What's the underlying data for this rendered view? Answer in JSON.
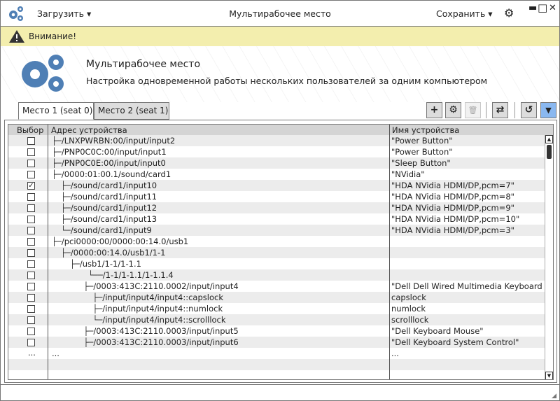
{
  "window": {
    "title": "Мультирабочее место",
    "load_menu": "Загрузить",
    "save_menu": "Сохранить",
    "minimize": "▬",
    "maximize": "□",
    "close": "✕"
  },
  "warning": {
    "text": "Внимание!"
  },
  "header": {
    "title": "Мультирабочее место",
    "subtitle": "Настройка одновременной работы нескольких пользователей за одним компьютером"
  },
  "tabs": [
    {
      "label": "Место 1 (seat 0)",
      "active": true
    },
    {
      "label": "Место 2 (seat 1)",
      "active": false
    }
  ],
  "toolbar": {
    "add": "+",
    "settings": "⚙",
    "delete": "🗑",
    "swap": "⇄",
    "refresh": "↺",
    "filter": "▼",
    "accent": "#8ab8f0"
  },
  "table": {
    "columns": [
      "Выбор",
      "Адрес устройства",
      "Имя устройства"
    ],
    "rows": [
      {
        "checked": false,
        "level": 0,
        "conn": "├─",
        "addr": "/LNXPWRBN:00/input/input2",
        "name": "\"Power Button\""
      },
      {
        "checked": false,
        "level": 0,
        "conn": "├─",
        "addr": "/PNP0C0C:00/input/input1",
        "name": "\"Power Button\""
      },
      {
        "checked": false,
        "level": 0,
        "conn": "├─",
        "addr": "/PNP0C0E:00/input/input0",
        "name": "\"Sleep Button\""
      },
      {
        "checked": false,
        "level": 0,
        "conn": "├─",
        "addr": "/0000:01:00.1/sound/card1",
        "name": "\"NVidia\""
      },
      {
        "checked": true,
        "level": 1,
        "conn": "├─",
        "addr": "/sound/card1/input10",
        "name": "\"HDA NVidia HDMI/DP,pcm=7\""
      },
      {
        "checked": false,
        "level": 1,
        "conn": "├─",
        "addr": "/sound/card1/input11",
        "name": "\"HDA NVidia HDMI/DP,pcm=8\""
      },
      {
        "checked": false,
        "level": 1,
        "conn": "├─",
        "addr": "/sound/card1/input12",
        "name": "\"HDA NVidia HDMI/DP,pcm=9\""
      },
      {
        "checked": false,
        "level": 1,
        "conn": "├─",
        "addr": "/sound/card1/input13",
        "name": "\"HDA NVidia HDMI/DP,pcm=10\""
      },
      {
        "checked": false,
        "level": 1,
        "conn": "└─",
        "addr": "/sound/card1/input9",
        "name": "\"HDA NVidia HDMI/DP,pcm=3\""
      },
      {
        "checked": false,
        "level": 0,
        "conn": "├─",
        "addr": "/pci0000:00/0000:00:14.0/usb1",
        "name": ""
      },
      {
        "checked": false,
        "level": 1,
        "conn": "├─",
        "addr": "/0000:00:14.0/usb1/1-1",
        "name": ""
      },
      {
        "checked": false,
        "level": 2,
        "conn": "├─",
        "addr": "/usb1/1-1/1-1.1",
        "name": ""
      },
      {
        "checked": false,
        "level": 4,
        "conn": "└──",
        "addr": "/1-1/1-1.1/1-1.1.4",
        "name": ""
      },
      {
        "checked": false,
        "level": 3.5,
        "conn": "├─",
        "addr": "/0003:413C:2110.0002/input/input4",
        "name": "\"Dell Dell Wired Multimedia Keyboard\""
      },
      {
        "checked": false,
        "level": 4.5,
        "conn": "├─",
        "addr": "/input/input4/input4::capslock",
        "name": "capslock"
      },
      {
        "checked": false,
        "level": 4.5,
        "conn": "├─",
        "addr": "/input/input4/input4::numlock",
        "name": "numlock"
      },
      {
        "checked": false,
        "level": 4.5,
        "conn": "└─",
        "addr": "/input/input4/input4::scrolllock",
        "name": "scrolllock"
      },
      {
        "checked": false,
        "level": 3.5,
        "conn": "├─",
        "addr": "/0003:413C:2110.0003/input/input5",
        "name": "\"Dell Keyboard Mouse\""
      },
      {
        "checked": false,
        "level": 3.5,
        "conn": "├─",
        "addr": "/0003:413C:2110.0003/input/input6",
        "name": "\"Dell Keyboard System Control\""
      },
      {
        "checked": null,
        "level": 0,
        "conn": "",
        "addr": "...",
        "name": "...",
        "sel": "..."
      },
      {
        "checked": null,
        "level": 0,
        "conn": "",
        "addr": "",
        "name": ""
      }
    ]
  }
}
